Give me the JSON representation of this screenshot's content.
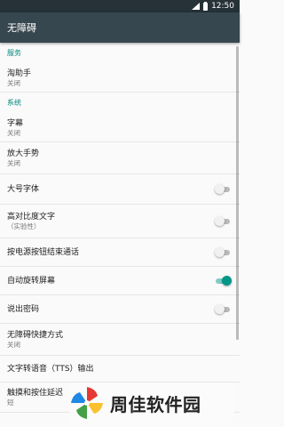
{
  "status_bar": {
    "time": "12:50"
  },
  "app_bar": {
    "title": "无障碍"
  },
  "sections": {
    "services": {
      "header": "服务"
    },
    "system": {
      "header": "系统"
    }
  },
  "items": {
    "taobao_helper": {
      "title": "淘助手",
      "summary": "关闭"
    },
    "captions": {
      "title": "字幕",
      "summary": "关闭"
    },
    "magnification": {
      "title": "放大手势",
      "summary": "关闭"
    },
    "large_text": {
      "title": "大号字体",
      "enabled": false
    },
    "high_contrast": {
      "title": "高对比度文字",
      "summary": "（实验性）",
      "enabled": false
    },
    "power_ends_call": {
      "title": "按电源按钮结束通话",
      "enabled": false
    },
    "auto_rotate": {
      "title": "自动旋转屏幕",
      "enabled": true
    },
    "speak_passwords": {
      "title": "说出密码",
      "enabled": false
    },
    "shortcut": {
      "title": "无障碍快捷方式",
      "summary": "关闭"
    },
    "tts": {
      "title": "文字转语音（TTS）输出"
    },
    "touch_delay": {
      "title": "触摸和按住延迟",
      "summary": "短"
    }
  },
  "watermark": {
    "text": "周佳软件园"
  },
  "colors": {
    "accent": "#00897b",
    "app_bar": "#37474f",
    "status_bar": "#263238",
    "switch_on": "#009688"
  }
}
